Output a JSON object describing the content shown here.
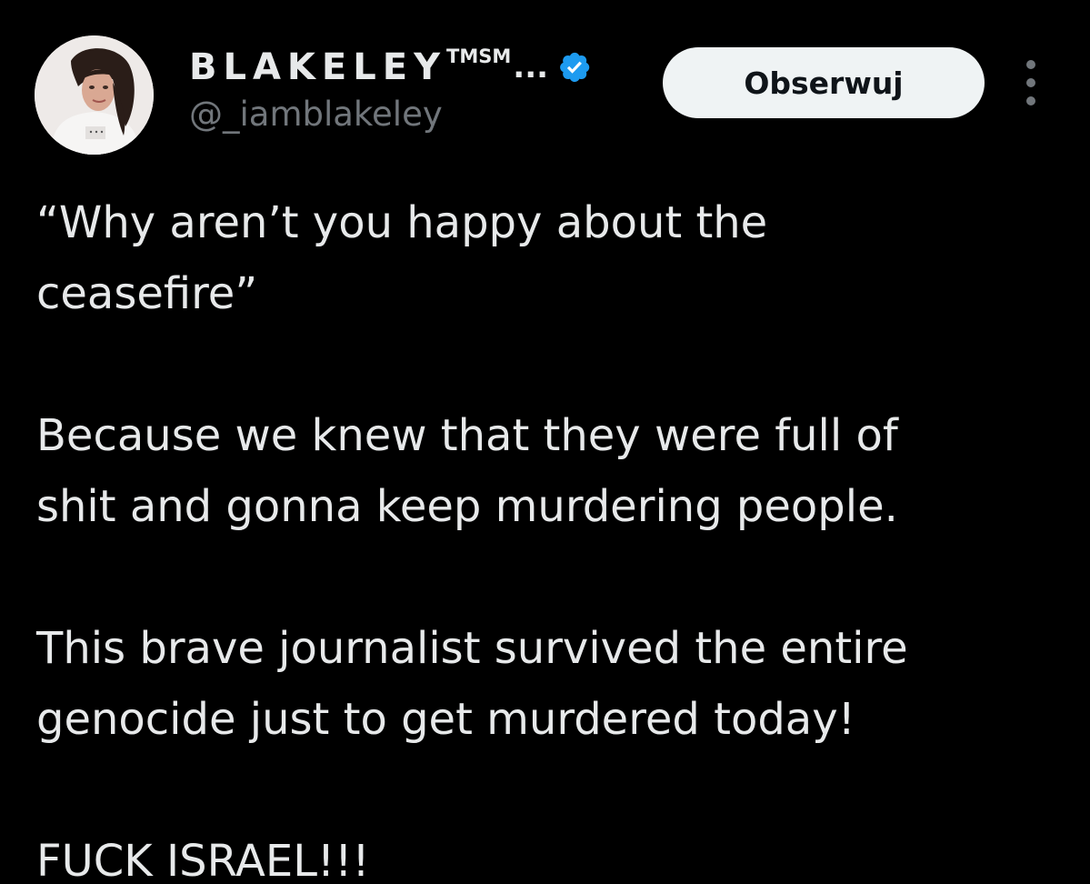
{
  "tweet": {
    "author": {
      "display_name": "BLAKELEY",
      "display_name_superscript": "TMSM",
      "truncation": "...",
      "handle": "@_iamblakeley",
      "verified": true,
      "verified_color": "#1d9bf0",
      "avatar_icon": "profile-photo"
    },
    "follow_button_label": "Obserwuj",
    "more_icon": "more-options-icon",
    "paragraphs": [
      "“Why aren’t you happy about the\nceasefire”",
      "Because we knew that they were full of\nshit and gonna keep murdering people.",
      "This brave journalist survived the entire\ngenocide just to get murdered today!",
      "FUCK ISRAEL!!!"
    ]
  },
  "colors": {
    "background": "#000000",
    "text_primary": "#e7e9ea",
    "text_secondary": "#71767b",
    "button_bg": "#eff3f4",
    "button_text": "#0f1419",
    "accent": "#1d9bf0"
  }
}
